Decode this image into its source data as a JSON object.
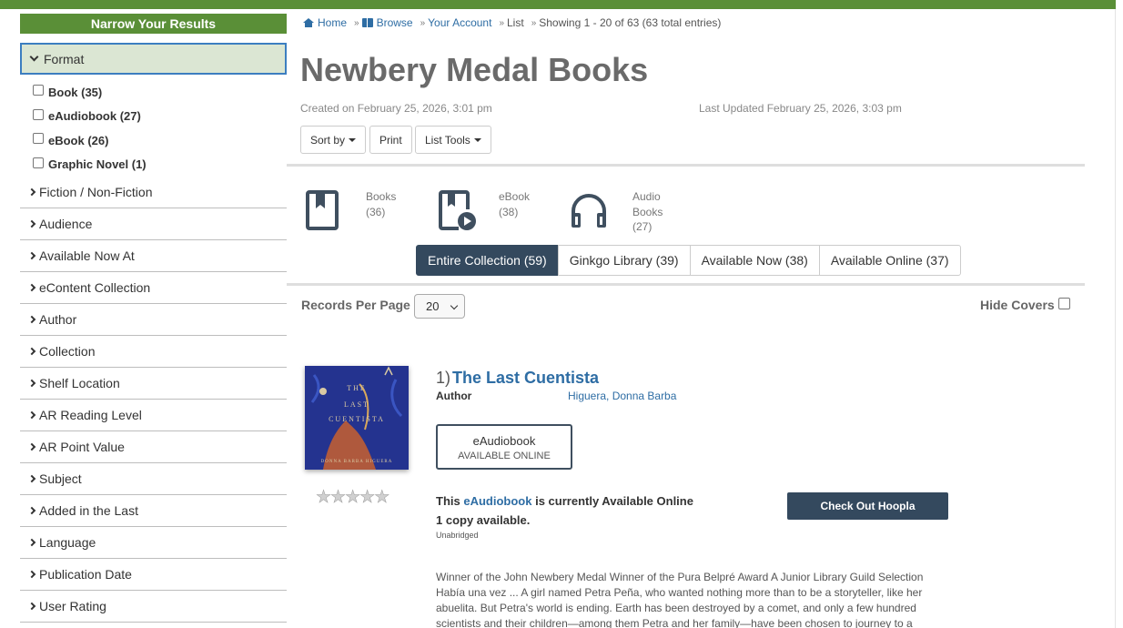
{
  "sidebar": {
    "header": "Narrow Your Results",
    "open_facet": "Format",
    "format_options": [
      {
        "label": "Book (35)"
      },
      {
        "label": "eAudiobook (27)"
      },
      {
        "label": "eBook (26)"
      },
      {
        "label": "Graphic Novel (1)"
      }
    ],
    "facets": [
      "Fiction / Non-Fiction",
      "Audience",
      "Available Now At",
      "eContent Collection",
      "Author",
      "Collection",
      "Shelf Location",
      "AR Reading Level",
      "AR Point Value",
      "Subject",
      "Added in the Last",
      "Language",
      "Publication Date",
      "User Rating"
    ]
  },
  "breadcrumb": {
    "home": "Home",
    "browse": "Browse",
    "account": "Your Account",
    "list": "List",
    "showing": "Showing 1 - 20 of 63 (63 total entries)"
  },
  "list": {
    "title": "Newbery Medal Books",
    "created": "Created on February 25, 2026, 3:01 pm",
    "updated": "Last Updated February 25, 2026, 3:03 pm",
    "sort_label": "Sort by",
    "print_label": "Print",
    "tools_label": "List Tools"
  },
  "formats": {
    "books": {
      "label": "Books",
      "count": "(36)"
    },
    "ebook": {
      "label": "eBook",
      "count": "(38)"
    },
    "audio": {
      "label1": "Audio",
      "label2": "Books",
      "count": "(27)"
    }
  },
  "tabs": [
    "Entire Collection (59)",
    "Ginkgo Library (39)",
    "Available Now (38)",
    "Available Online (37)"
  ],
  "records_per_page": {
    "label": "Records Per Page",
    "value": "20"
  },
  "hide_covers": "Hide Covers",
  "record": {
    "number": "1)",
    "title": "The Last Cuentista",
    "author_label": "Author",
    "author": "Higuera, Donna Barba",
    "cover_lines": [
      "THE",
      "LAST",
      "CUENTISTA",
      "DONNA BARBA HIGUERA"
    ],
    "format_name": "eAudiobook",
    "format_status": "AVAILABLE ONLINE",
    "avail_pre": "This",
    "avail_link": "eAudiobook",
    "avail_post": "is currently Available Online",
    "copies": "1 copy available.",
    "edition": "Unabridged",
    "action": "Check Out Hoopla",
    "rating": 0,
    "description": "Winner of the John Newbery Medal Winner of the Pura Belpré Award A Junior Library Guild Selection Había una vez ... A girl named Petra Peña, who wanted nothing more than to be a storyteller, like her abuelita. But Petra's world is ending. Earth has been destroyed by a comet, and only a few hundred scientists and their children—among them Petra and her family—have been chosen to journey to a"
  },
  "colors": {
    "brand_green": "#5a8f37",
    "navy": "#34495e",
    "link_blue": "#2e6da4"
  }
}
